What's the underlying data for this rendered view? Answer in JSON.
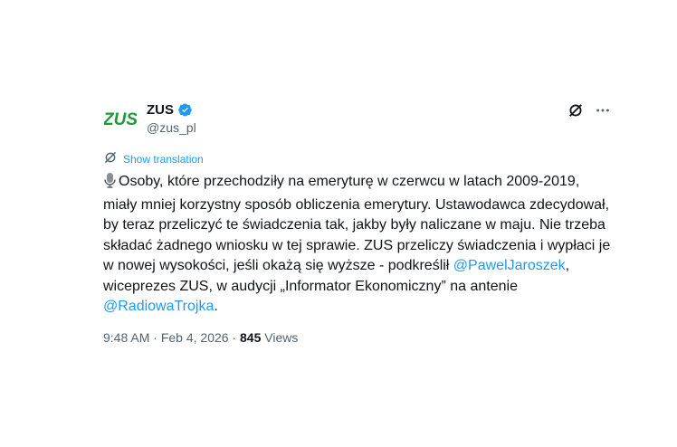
{
  "author": {
    "display_name": "ZUS",
    "handle": "@zus_pl",
    "logo_text": "ZUS",
    "verified": true
  },
  "translation": {
    "label": "Show translation"
  },
  "tweet": {
    "emoji": "microphone-emoji",
    "segment_1": "Osoby, które przechodziły na emeryturę w czerwcu w latach 2009-2019, miały mniej korzystny sposób obliczenia emerytury. Ustawodawca zdecydował, by teraz przeliczyć te świadczenia tak, jakby były naliczane w maju. Nie trzeba składać żadnego wniosku w tej sprawie. ZUS przeliczy świadczenia i wypłaci je w nowej wysokości, jeśli okażą się wyższe - podkreślił ",
    "mention_1": "@PawelJaroszek",
    "segment_2": ", wiceprezes ZUS, w audycji „Informator Ekonomiczny” na antenie ",
    "mention_2": "@RadiowaTrojka",
    "segment_3": "."
  },
  "meta": {
    "time": "9:48 AM",
    "separator_1": " · ",
    "date": "Feb 4, 2026",
    "separator_2": " · ",
    "views_count": "845",
    "views_label": " Views"
  },
  "icons": {
    "grok": "grok-icon",
    "more": "more-icon",
    "translate": "translate-icon",
    "verified": "verified-badge-icon"
  },
  "colors": {
    "link": "#1d9bf0",
    "logo_green": "#1a9c3b",
    "secondary_text": "#536471",
    "primary_text": "#0f1419"
  }
}
